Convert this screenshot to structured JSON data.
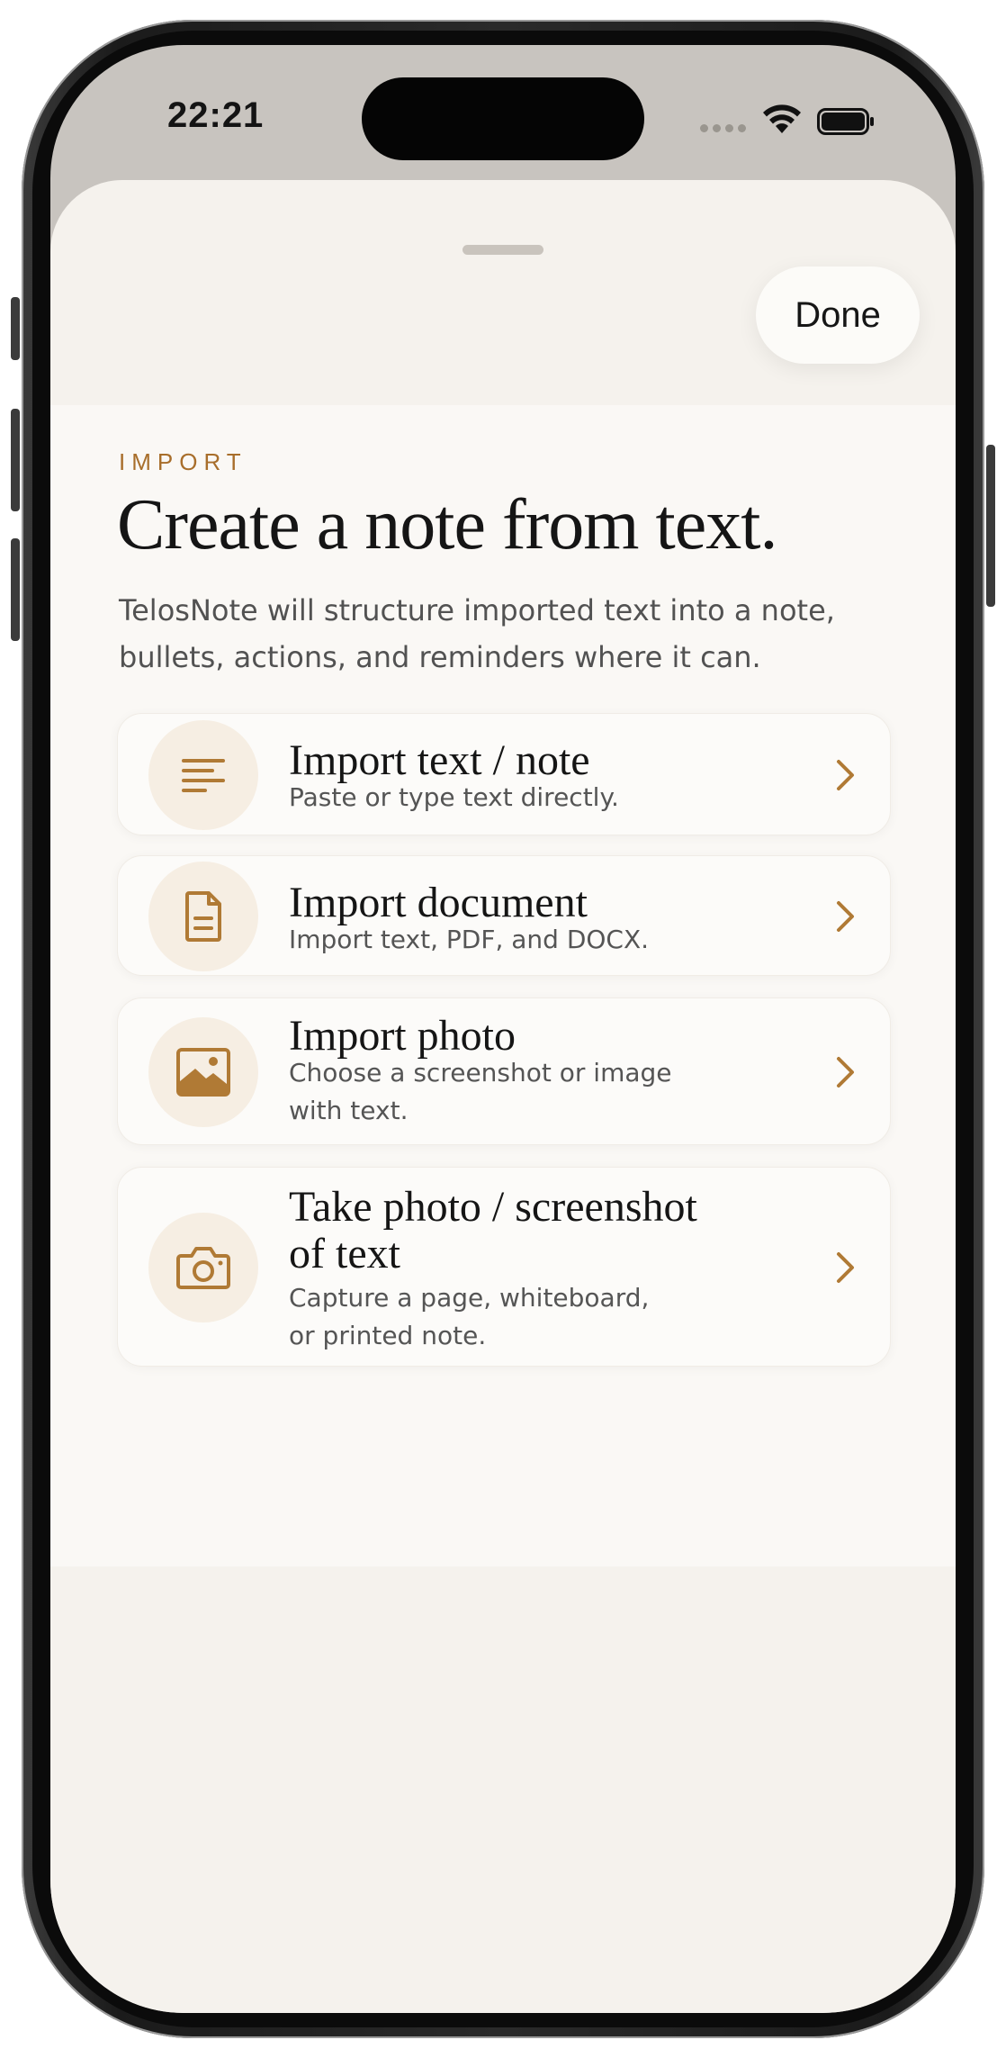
{
  "status_bar": {
    "time": "22:21"
  },
  "sheet": {
    "done_label": "Done"
  },
  "header": {
    "eyebrow": "IMPORT",
    "title": "Create a note from text.",
    "subtitle": "TelosNote will structure imported text into a note, bullets, actions, and reminders where it can."
  },
  "options": [
    {
      "title": "Import text / note",
      "description": "Paste or type text directly.",
      "icon": "text-lines-icon"
    },
    {
      "title": "Import document",
      "description": "Import text, PDF, and DOCX.",
      "icon": "document-icon"
    },
    {
      "title": "Import photo",
      "description": "Choose a screenshot or image with text.",
      "icon": "image-icon"
    },
    {
      "title": "Take photo / screenshot of text",
      "description": "Capture a page, whiteboard, or printed note.",
      "icon": "camera-icon"
    }
  ],
  "colors": {
    "accent": "#b07a35",
    "sheet_background": "#f5f2ed",
    "content_background": "#faf8f5",
    "status_bar_background": "#c8c4bf",
    "icon_circle": "#f6eee3"
  }
}
